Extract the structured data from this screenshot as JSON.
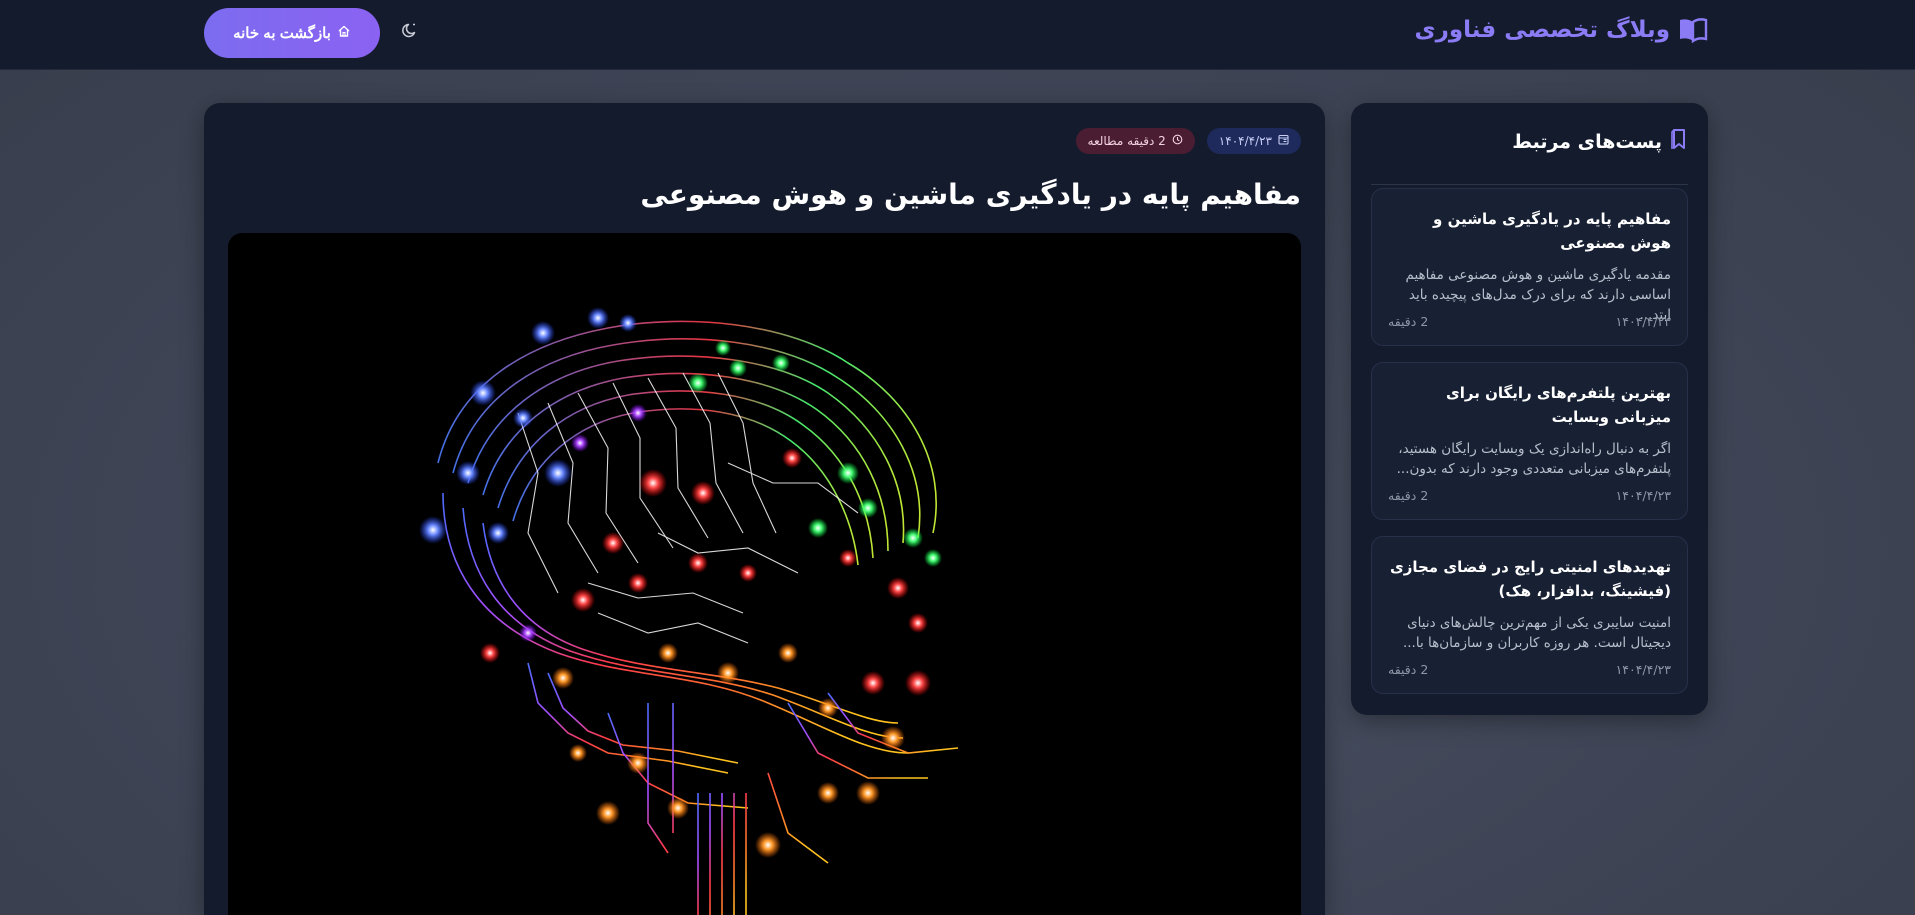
{
  "header": {
    "brand_title": "وبلاگ تخصصی فناوری",
    "home_button_label": "بازگشت به خانه",
    "brand_icon": "open-book-icon",
    "theme_icon": "moon-icon",
    "home_icon": "home-icon"
  },
  "article": {
    "date": "۱۴۰۴/۴/۲۳",
    "reading_time": "2 دقیقه مطالعه",
    "title": "مفاهیم پایه در یادگیری ماشین و هوش مصنوعی",
    "hero_image": "circuit-brain-image"
  },
  "sidebar": {
    "title": "پست‌های مرتبط",
    "icon": "bookmark-icon",
    "posts": [
      {
        "title": "مفاهیم پایه در یادگیری ماشین و هوش مصنوعی",
        "excerpt": "مقدمه یادگیری ماشین و هوش مصنوعی مفاهیم اساسی دارند که برای درک مدل‌های پیچیده باید ابتد...",
        "date": "۱۴۰۴/۴/۲۳",
        "reading_time": "2 دقیقه"
      },
      {
        "title": "بهترین پلتفرم‌های رایگان برای میزبانی وبسایت",
        "excerpt": "اگر به دنبال راه‌اندازی یک وبسایت رایگان هستید، پلتفرم‌های میزبانی متعددی وجود دارند که بدون...",
        "date": "۱۴۰۴/۴/۲۳",
        "reading_time": "2 دقیقه"
      },
      {
        "title": "تهدیدهای امنیتی رایج در فضای مجازی (فیشینگ، بدافزار، هک)",
        "excerpt": "امنیت سایبری یکی از مهم‌ترین چالش‌های دنیای دیجیتال است. هر روزه کاربران و سازمان‌ها با...",
        "date": "۱۴۰۴/۴/۲۳",
        "reading_time": "2 دقیقه"
      }
    ]
  },
  "colors": {
    "accent": "#8b7cf6",
    "surface": "#141b2d",
    "chip_date": "#1e2a5c",
    "chip_read": "#4a1d33"
  }
}
